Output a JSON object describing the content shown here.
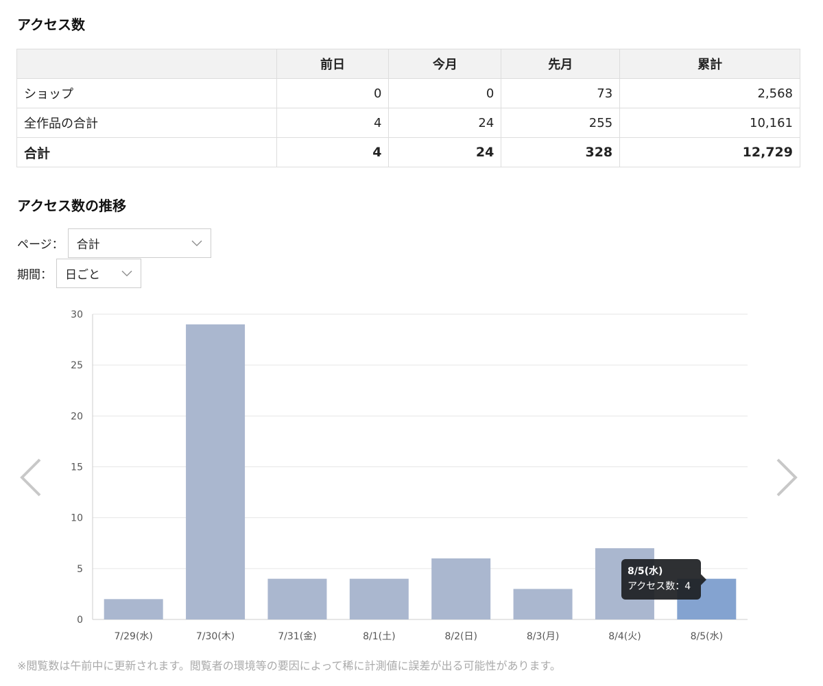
{
  "sections": {
    "access_title": "アクセス数",
    "trend_title": "アクセス数の推移"
  },
  "table": {
    "headers": [
      "",
      "前日",
      "今月",
      "先月",
      "累計"
    ],
    "rows": [
      {
        "label": "ショップ",
        "cells": [
          "0",
          "0",
          "73",
          "2,568"
        ]
      },
      {
        "label": "全作品の合計",
        "cells": [
          "4",
          "24",
          "255",
          "10,161"
        ]
      }
    ],
    "total": {
      "label": "合計",
      "cells": [
        "4",
        "24",
        "328",
        "12,729"
      ]
    }
  },
  "filters": {
    "page_label": "ページ：",
    "page_value": "合計",
    "period_label": "期間：",
    "period_value": "日ごと"
  },
  "chart_data": {
    "type": "bar",
    "categories": [
      "7/29(水)",
      "7/30(木)",
      "7/31(金)",
      "8/1(土)",
      "8/2(日)",
      "8/3(月)",
      "8/4(火)",
      "8/5(水)"
    ],
    "values": [
      2,
      29,
      4,
      4,
      6,
      3,
      7,
      4
    ],
    "ylim": [
      0,
      30
    ],
    "yticks": [
      0,
      5,
      10,
      15,
      20,
      25,
      30
    ],
    "grid": true,
    "bar_color": "#aab7cf",
    "highlight_color": "#84a3d0",
    "highlight_index": 7
  },
  "tooltip": {
    "title": "8/5(水)",
    "line": "アクセス数：4"
  },
  "nav": {
    "prev_icon": "chevron-left-icon",
    "next_icon": "chevron-right-icon"
  },
  "footnote": "※閲覧数は午前中に更新されます。閲覧者の環境等の要因によって稀に計測値に誤差が出る可能性があります。"
}
